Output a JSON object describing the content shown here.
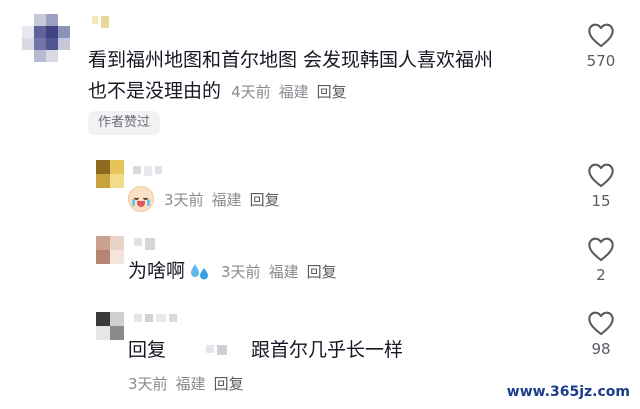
{
  "comments": [
    {
      "text_line1": "看到福州地图和首尔地图 会发现韩国人喜欢福州",
      "text_line2": "也不是没理由的",
      "time": "4天前",
      "location": "福建",
      "reply": "回复",
      "badge": "作者赞过",
      "likes": "570"
    },
    {
      "emoji": "crying-baby-emoji",
      "time": "3天前",
      "location": "福建",
      "reply": "回复",
      "likes": "15"
    },
    {
      "text": "为啥啊",
      "emoji": "sweat-drops-emoji",
      "time": "3天前",
      "location": "福建",
      "reply": "回复",
      "likes": "2"
    },
    {
      "prefix": "回复",
      "text": "跟首尔几乎长一样",
      "time": "3天前",
      "location": "福建",
      "reply": "回复",
      "likes": "98"
    }
  ],
  "watermark": "www.365jz.com"
}
